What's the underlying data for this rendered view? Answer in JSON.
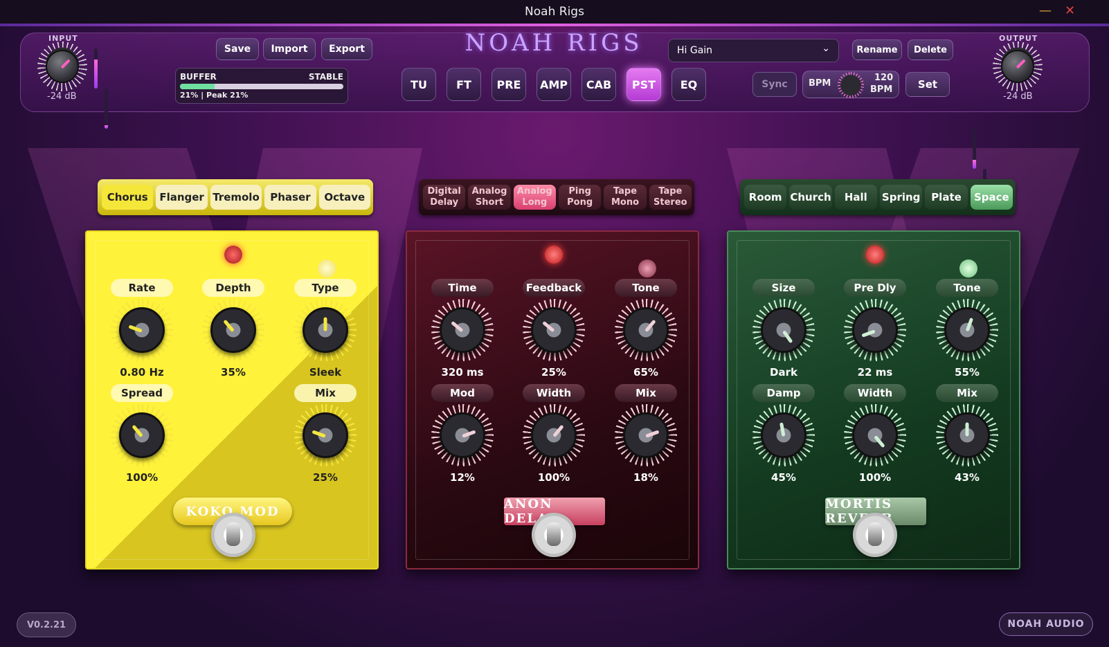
{
  "window": {
    "title": "Noah Rigs",
    "minimize_icon": "minimize-icon",
    "close_icon": "close-icon"
  },
  "header": {
    "logo": "NOAH RIGS",
    "input": {
      "label": "INPUT",
      "value": "-24 dB"
    },
    "output": {
      "label": "OUTPUT",
      "value": "-24 dB"
    },
    "file_buttons": [
      "Save",
      "Import",
      "Export"
    ],
    "buffer": {
      "label": "BUFFER",
      "status": "STABLE",
      "text": "21% | Peak 21%",
      "level": 0.21
    },
    "modules": [
      {
        "label": "TU",
        "active": false
      },
      {
        "label": "FT",
        "active": false
      },
      {
        "label": "PRE",
        "active": false
      },
      {
        "label": "AMP",
        "active": false
      },
      {
        "label": "CAB",
        "active": false
      },
      {
        "label": "PST",
        "active": true
      },
      {
        "label": "EQ",
        "active": false
      }
    ],
    "preset": {
      "selected": "Hi Gain"
    },
    "preset_buttons": [
      "Rename",
      "Delete"
    ],
    "sync_label": "Sync",
    "bpm_label": "BPM",
    "bpm_value": "120",
    "bpm_unit": "BPM",
    "set_label": "Set"
  },
  "mod_pedal": {
    "tabs": [
      "Chorus",
      "Flanger",
      "Tremolo",
      "Phaser",
      "Octave"
    ],
    "selected_tab": "Chorus",
    "name": "KOKO MOD",
    "knobs": [
      {
        "label": "Rate",
        "value": "0.80 Hz"
      },
      {
        "label": "Depth",
        "value": "35%"
      },
      {
        "label": "Type",
        "value": "Sleek"
      },
      {
        "label": "Spread",
        "value": "100%"
      },
      {
        "label": "Mix",
        "value": "25%"
      }
    ],
    "accent": "#f5e63a"
  },
  "delay_pedal": {
    "tabs": [
      "Digital Delay",
      "Analog Short",
      "Analog Long",
      "Ping Pong",
      "Tape Mono",
      "Tape Stereo"
    ],
    "selected_tab": "Analog Long",
    "name": "ANON DELAY",
    "knobs": [
      {
        "label": "Time",
        "value": "320 ms"
      },
      {
        "label": "Feedback",
        "value": "25%"
      },
      {
        "label": "Tone",
        "value": "65%"
      },
      {
        "label": "Mod",
        "value": "12%"
      },
      {
        "label": "Width",
        "value": "100%"
      },
      {
        "label": "Mix",
        "value": "18%"
      }
    ],
    "accent": "#ff5a8a"
  },
  "reverb_pedal": {
    "tabs": [
      "Room",
      "Church",
      "Hall",
      "Spring",
      "Plate",
      "Space"
    ],
    "selected_tab": "Space",
    "name": "MORTIS REVERB",
    "knobs": [
      {
        "label": "Size",
        "value": "Dark"
      },
      {
        "label": "Pre Dly",
        "value": "22 ms"
      },
      {
        "label": "Tone",
        "value": "55%"
      },
      {
        "label": "Damp",
        "value": "45%"
      },
      {
        "label": "Width",
        "value": "100%"
      },
      {
        "label": "Mix",
        "value": "43%"
      }
    ],
    "accent": "#9be0a8"
  },
  "footer": {
    "version": "V0.2.21",
    "brand": "NOAH AUDIO"
  }
}
